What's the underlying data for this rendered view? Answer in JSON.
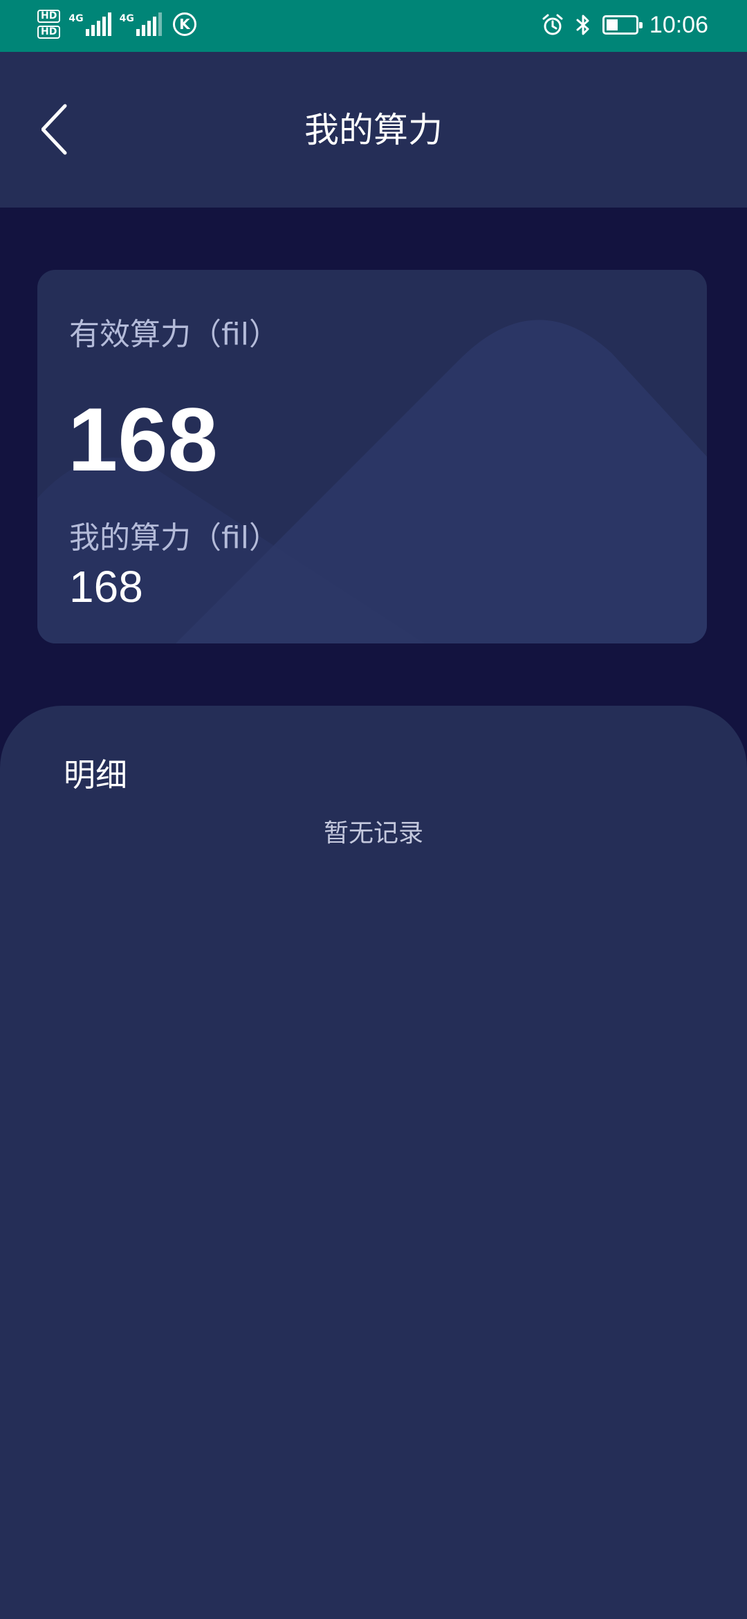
{
  "status_bar": {
    "hd_badges": [
      "HD",
      "HD"
    ],
    "network_1": "4G",
    "network_2": "4G",
    "k_badge": "K",
    "time": "10:06",
    "battery_level": 0.35,
    "icons": [
      "alarm-icon",
      "bluetooth-icon",
      "battery-icon"
    ]
  },
  "header": {
    "title": "我的算力",
    "back_icon": "chevron-left-icon"
  },
  "summary": {
    "effective_label": "有效算力（fil）",
    "effective_value": "168",
    "mine_label": "我的算力（fil）",
    "mine_value": "168"
  },
  "detail": {
    "title": "明细",
    "empty_text": "暂无记录"
  },
  "colors": {
    "status_bar": "#008577",
    "page_background": "#13133f",
    "panel": "#252e57",
    "muted_text": "#b4bbd9"
  }
}
